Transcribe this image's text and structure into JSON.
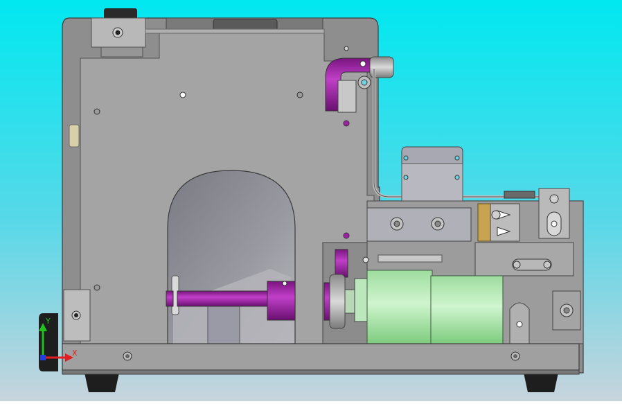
{
  "view": {
    "background_top": "#00E5EE",
    "background_bottom": "#C3D2DC",
    "housing_color": "#8E8E8E",
    "panel_color": "#A5A5A5",
    "purple_part_color": "#A020A8",
    "motor_color": "#A8E6A8",
    "feet_color": "#1E1E1E"
  },
  "triad": {
    "x_label": "X",
    "y_label": "Y",
    "x_color": "#E02020",
    "y_color": "#20C020",
    "z_color": "#2040E0"
  }
}
